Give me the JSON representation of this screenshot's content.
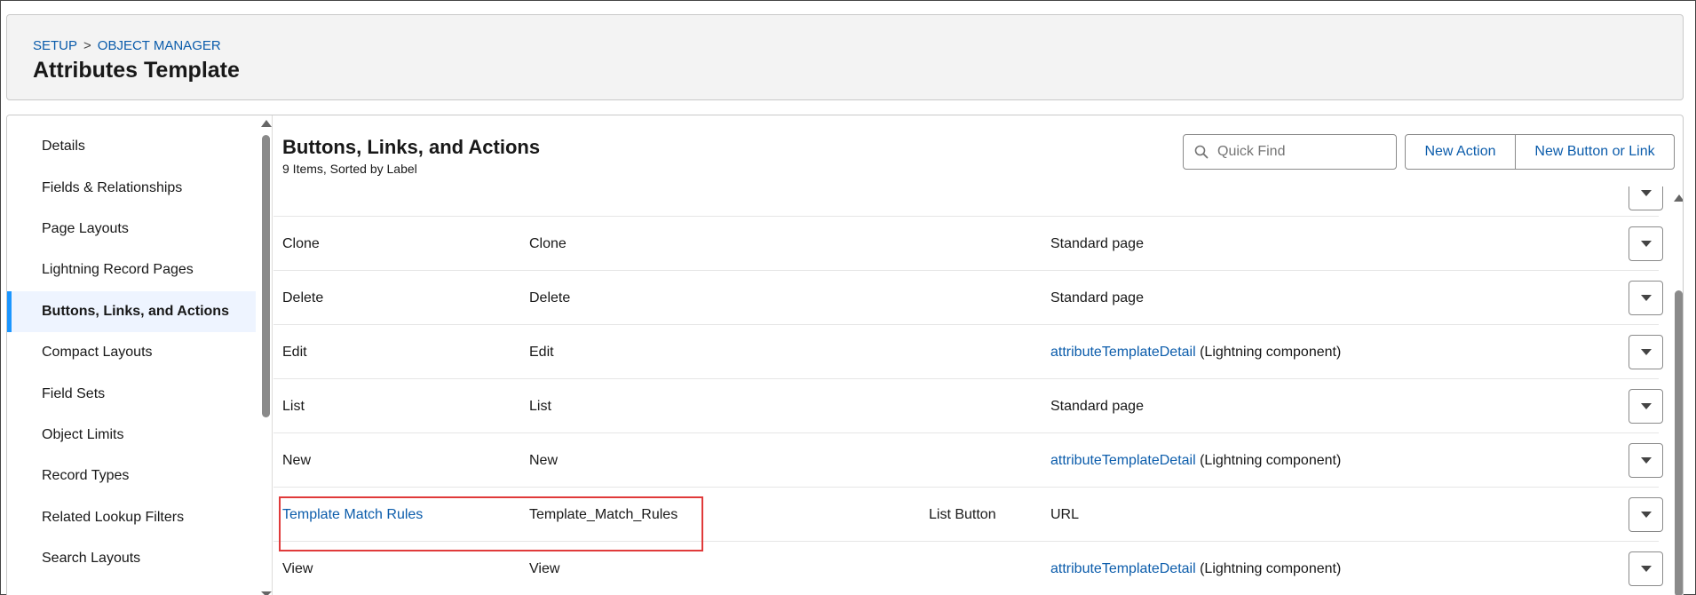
{
  "breadcrumb": {
    "setup": "SETUP",
    "separator": ">",
    "object_manager": "OBJECT MANAGER"
  },
  "page_title": "Attributes Template",
  "sidebar": {
    "items": [
      {
        "label": "Details",
        "active": false
      },
      {
        "label": "Fields & Relationships",
        "active": false
      },
      {
        "label": "Page Layouts",
        "active": false
      },
      {
        "label": "Lightning Record Pages",
        "active": false
      },
      {
        "label": "Buttons, Links, and Actions",
        "active": true
      },
      {
        "label": "Compact Layouts",
        "active": false
      },
      {
        "label": "Field Sets",
        "active": false
      },
      {
        "label": "Object Limits",
        "active": false
      },
      {
        "label": "Record Types",
        "active": false
      },
      {
        "label": "Related Lookup Filters",
        "active": false
      },
      {
        "label": "Search Layouts",
        "active": false
      }
    ]
  },
  "section": {
    "title": "Buttons, Links, and Actions",
    "subtitle": "9 Items, Sorted by Label"
  },
  "search": {
    "placeholder": "Quick Find",
    "icon": "search-icon"
  },
  "toolbar": {
    "new_action": "New Action",
    "new_button_or_link": "New Button or Link"
  },
  "rows": [
    {
      "label": "Clone",
      "name": "Clone",
      "type": "",
      "overridden_text": "Standard page",
      "overridden_link": "",
      "label_is_link": false
    },
    {
      "label": "Delete",
      "name": "Delete",
      "type": "",
      "overridden_text": "Standard page",
      "overridden_link": "",
      "label_is_link": false
    },
    {
      "label": "Edit",
      "name": "Edit",
      "type": "",
      "overridden_link": "attributeTemplateDetail",
      "overridden_text": " (Lightning component)",
      "label_is_link": false
    },
    {
      "label": "List",
      "name": "List",
      "type": "",
      "overridden_text": "Standard page",
      "overridden_link": "",
      "label_is_link": false
    },
    {
      "label": "New",
      "name": "New",
      "type": "",
      "overridden_link": "attributeTemplateDetail",
      "overridden_text": " (Lightning component)",
      "label_is_link": false
    },
    {
      "label": "Template Match Rules",
      "name": "Template_Match_Rules",
      "type": "List Button",
      "overridden_text": "URL",
      "overridden_link": "",
      "label_is_link": true
    },
    {
      "label": "View",
      "name": "View",
      "type": "",
      "overridden_link": "attributeTemplateDetail",
      "overridden_text": " (Lightning component)",
      "label_is_link": false
    }
  ]
}
